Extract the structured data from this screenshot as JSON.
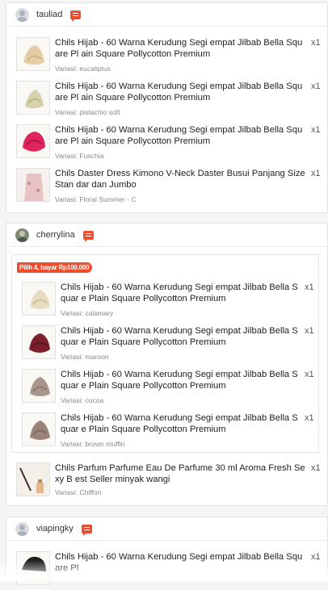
{
  "orders": [
    {
      "username": "tauliad",
      "items": [
        {
          "title": "Chils Hijab - 60 Warna Kerudung Segi empat Jilbab Bella Square Pl ain Square Pollycotton Premium",
          "variation": "Variasi: eucaliptus",
          "qty": "x1"
        },
        {
          "title": "Chils Hijab - 60 Warna Kerudung Segi empat Jilbab Bella Square Pl ain Square Pollycotton Premium",
          "variation": "Variasi: pistachio soft",
          "qty": "x1"
        },
        {
          "title": "Chils Hijab - 60 Warna Kerudung Segi empat Jilbab Bella Square Pl ain Square Pollycotton Premium",
          "variation": "Variasi: Fuschia",
          "qty": "x1"
        },
        {
          "title": "Chils Daster Dress Kimono V-Neck Daster Busui Panjang Size Stan dar dan Jumbo",
          "variation": "Variasi: Floral Summer - C",
          "qty": "x1"
        }
      ]
    },
    {
      "username": "cherrylina",
      "promo_label": "Pilih 4, bayar Rp100.000",
      "bundle_items": [
        {
          "title": "Chils Hijab - 60 Warna Kerudung Segi empat Jilbab Bella Squar e Plain Square Pollycotton Premium",
          "variation": "Variasi: calamary",
          "qty": "x1"
        },
        {
          "title": "Chils Hijab - 60 Warna Kerudung Segi empat Jilbab Bella Squar e Plain Square Pollycotton Premium",
          "variation": "Variasi: maroon",
          "qty": "x1"
        },
        {
          "title": "Chils Hijab - 60 Warna Kerudung Segi empat Jilbab Bella Squar e Plain Square Pollycotton Premium",
          "variation": "Variasi: cocoa",
          "qty": "x1"
        },
        {
          "title": "Chils Hijab - 60 Warna Kerudung Segi empat Jilbab Bella Squar e Plain Square Pollycotton Premium",
          "variation": "Variasi: brown muffin",
          "qty": "x1"
        }
      ],
      "items": [
        {
          "title": "Chils Parfum Parfume Eau De Parfume 30 ml Aroma Fresh Sexy B est Seller minyak wangi",
          "variation": "Variasi: Chiffon",
          "qty": "x1"
        }
      ]
    },
    {
      "username": "viapingky",
      "items": [
        {
          "title": "Chils Hijab - 60 Warna Kerudung Segi empat Jilbab Bella Square Pl",
          "qty": "x1"
        }
      ]
    }
  ],
  "colors": {
    "accent": "#ee4d2d",
    "muted": "#888888"
  },
  "icons": {
    "avatar": "user-avatar-icon",
    "chat": "chat-icon"
  }
}
